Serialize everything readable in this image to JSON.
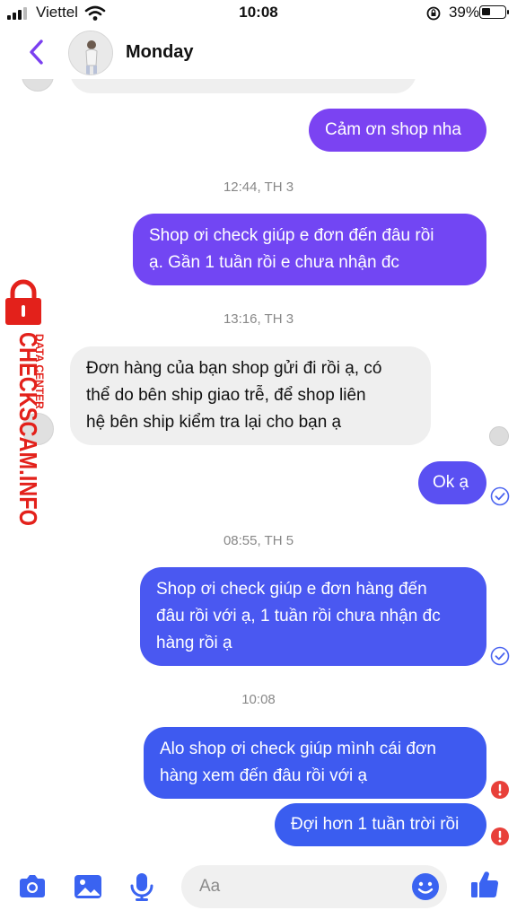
{
  "status_bar": {
    "carrier": "Viettel",
    "time": "10:08",
    "battery": "39%",
    "battery_level": 0.39
  },
  "header": {
    "contact_name": "Monday"
  },
  "watermark": {
    "brand": "CHECKSCAM.INFO",
    "tag": "DATA CENTER"
  },
  "messages": [
    {
      "type": "out",
      "text": "Cảm ơn shop nha"
    },
    {
      "type": "timestamp",
      "text": "12:44, TH 3"
    },
    {
      "type": "out",
      "lines": [
        "Shop ơi check giúp e đơn đến đâu rồi",
        "ạ. Gần 1 tuần rồi e chưa nhận đc"
      ]
    },
    {
      "type": "timestamp",
      "text": "13:16, TH 3"
    },
    {
      "type": "in",
      "lines": [
        "Đơn hàng của bạn shop gửi đi rồi ạ, có",
        "thể do bên ship giao trễ, để shop liên",
        "hệ bên ship kiểm tra lại cho bạn ạ"
      ]
    },
    {
      "type": "out",
      "text": "Ok ạ",
      "status": "sent"
    },
    {
      "type": "timestamp",
      "text": "08:55, TH 5"
    },
    {
      "type": "out",
      "lines": [
        "Shop ơi check giúp e đơn hàng đến",
        "đâu rồi với ạ, 1 tuần rồi chưa nhận đc",
        "hàng rồi ạ"
      ],
      "status": "sent"
    },
    {
      "type": "timestamp",
      "text": "10:08"
    },
    {
      "type": "out",
      "lines": [
        "Alo shop ơi check giúp mình cái đơn",
        "hàng xem đến đâu rồi với ạ"
      ],
      "status": "failed"
    },
    {
      "type": "out",
      "text": "Đợi hơn 1 tuần trời rồi",
      "status": "failed"
    }
  ],
  "composer": {
    "placeholder": "Aa"
  },
  "toolbar": {
    "icons": [
      "camera-icon",
      "image-icon",
      "microphone-icon",
      "emoji-icon",
      "thumbs-up-icon"
    ]
  },
  "colors": {
    "accent": "#7a3ff0",
    "bubble_purple": "#7b43f2",
    "bubble_indigo": "#5b4ff2",
    "bubble_blue": "#3d5cf0",
    "incoming": "#efefef",
    "error": "#e8403a",
    "watermark": "#e3211b"
  }
}
